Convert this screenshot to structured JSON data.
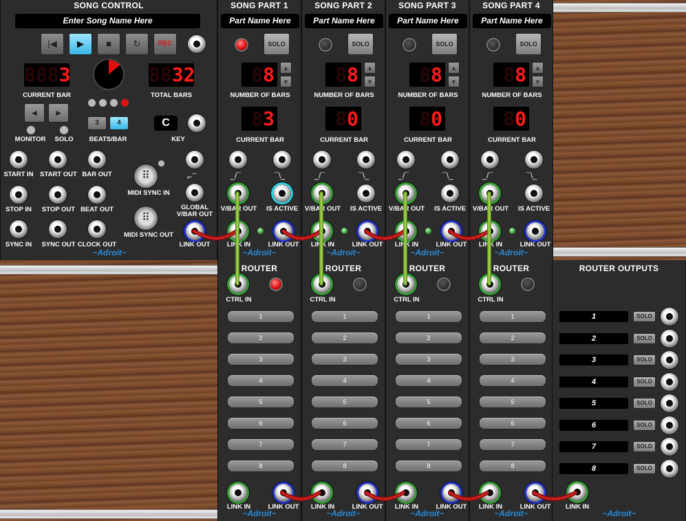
{
  "song_control": {
    "title": "SONG CONTROL",
    "song_name": "Enter Song Name Here",
    "rec_label": "REC",
    "current_bar_value": "3",
    "current_bar_label": "CURRENT BAR",
    "total_bars_value": "32",
    "total_bars_label": "TOTAL BARS",
    "monitor_label": "MONITOR",
    "solo_label": "SOLO",
    "beats_bar_label": "BEATS/BAR",
    "beats_opt_3": "3",
    "beats_opt_4": "4",
    "key_value": "C",
    "key_label": "KEY",
    "start_in": "START IN",
    "start_out": "START OUT",
    "bar_out": "BAR OUT",
    "stop_in": "STOP IN",
    "stop_out": "STOP OUT",
    "beat_out": "BEAT OUT",
    "sync_in": "SYNC IN",
    "sync_out": "SYNC OUT",
    "clock_out": "CLOCK OUT",
    "midi_sync_in": "MIDI SYNC IN",
    "midi_sync_out": "MIDI SYNC OUT",
    "global_vbar_out": "GLOBAL V/BAR OUT",
    "link_out": "LINK OUT",
    "brand": "~Adroit~"
  },
  "song_parts": [
    {
      "title": "SONG PART 1",
      "name": "Part Name Here",
      "solo": "SOLO",
      "num_bars": "8",
      "current_bar": "3"
    },
    {
      "title": "SONG PART 2",
      "name": "Part Name Here",
      "solo": "SOLO",
      "num_bars": "8",
      "current_bar": "0"
    },
    {
      "title": "SONG PART 3",
      "name": "Part Name Here",
      "solo": "SOLO",
      "num_bars": "8",
      "current_bar": "0"
    },
    {
      "title": "SONG PART 4",
      "name": "Part Name Here",
      "solo": "SOLO",
      "num_bars": "8",
      "current_bar": "0"
    }
  ],
  "part_labels": {
    "number_of_bars": "NUMBER OF BARS",
    "current_bar": "CURRENT BAR",
    "vbar_out": "V/BAR OUT",
    "is_active": "IS ACTIVE",
    "link_in": "LINK IN",
    "link_out": "LINK OUT",
    "brand": "~Adroit~"
  },
  "router": {
    "title": "ROUTER",
    "ctrl_in": "CTRL IN",
    "buttons": [
      "1",
      "2",
      "3",
      "4",
      "5",
      "6",
      "7",
      "8"
    ],
    "link_in": "LINK IN",
    "link_out": "LINK OUT",
    "brand": "~Adroit~"
  },
  "router_outputs": {
    "title": "ROUTER OUTPUTS",
    "rows": [
      "1",
      "2",
      "3",
      "4",
      "5",
      "6",
      "7",
      "8"
    ],
    "solo": "SOLO",
    "link_in": "LINK IN",
    "brand": "~Adroit~"
  },
  "colors": {
    "panel": "#2c2c2c",
    "cable_green": "#8cc43a",
    "cable_red": "#c41818",
    "led_red": "#ff1a1a",
    "brand_blue": "#2a8bd8",
    "play_active": "#5ec8f0"
  }
}
